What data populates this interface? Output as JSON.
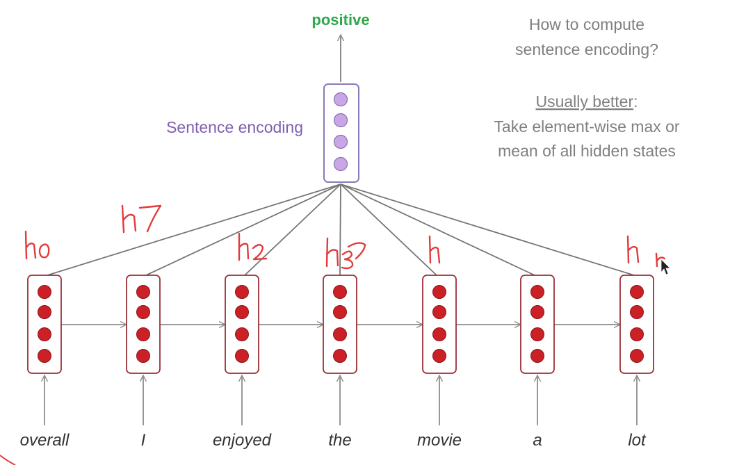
{
  "diagram": {
    "output_label": "positive",
    "encoding_label": "Sentence encoding",
    "question": {
      "line1": "How to compute",
      "line2": "sentence encoding?"
    },
    "answer": {
      "heading": "Usually better",
      "colon": ":",
      "line1": "Take element-wise max or",
      "line2": "mean of all hidden states"
    },
    "words": [
      "overall",
      "I",
      "enjoyed",
      "the",
      "movie",
      "a",
      "lot"
    ],
    "colors": {
      "output_text": "#2ea84a",
      "encoding_text": "#7e5fae",
      "encoding_box": "#8b7ab8",
      "encoding_node": "#c9a7e6",
      "hidden_box": "#9b2f38",
      "hidden_node": "#cc2027",
      "arrow": "#8c8c8c",
      "annotation": "#e23b3b"
    }
  }
}
